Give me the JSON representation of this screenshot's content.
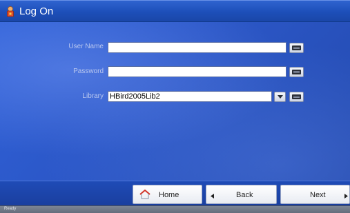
{
  "window": {
    "title": "Log On"
  },
  "form": {
    "username_label": "User Name",
    "username_value": "",
    "password_label": "Password",
    "password_value": "",
    "library_label": "Library",
    "library_value": "HBird2005Lib2"
  },
  "nav": {
    "home_label": "Home",
    "back_label": "Back",
    "next_label": "Next"
  },
  "status": {
    "text": "Ready"
  },
  "icons": {
    "title": "user-lock-icon",
    "keyboard": "keyboard-icon",
    "dropdown": "chevron-down-icon",
    "home": "home-icon",
    "back": "triangle-left-icon",
    "next": "triangle-right-icon"
  }
}
